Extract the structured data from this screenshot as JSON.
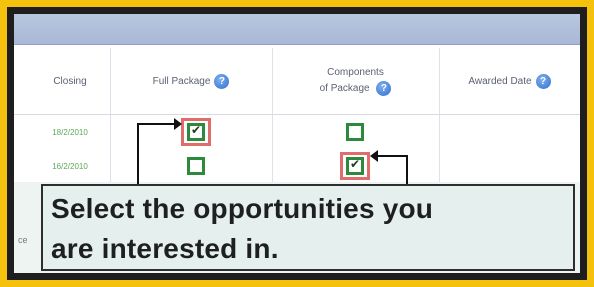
{
  "table": {
    "columns": [
      {
        "label": "Closing",
        "has_help": false
      },
      {
        "label": "Full Package",
        "has_help": true
      },
      {
        "label_line1": "Components",
        "label_line2": "of Package",
        "has_help": true
      },
      {
        "label": "Awarded Date",
        "has_help": true
      }
    ],
    "rows": [
      {
        "closing": "18/2/2010",
        "full_package_checked": true,
        "components_checked": false
      },
      {
        "closing": "16/2/2010",
        "full_package_checked": false,
        "components_checked": true
      }
    ]
  },
  "help_glyph": "?",
  "left_stub": "ce",
  "callout": {
    "line1": "Select the opportunities you",
    "line2": "are interested in."
  },
  "colors": {
    "outer_border": "#f4c20d",
    "checkbox": "#2d8a3c",
    "highlight": "#e06c6c",
    "callout_bg": "#e5f0ee"
  }
}
